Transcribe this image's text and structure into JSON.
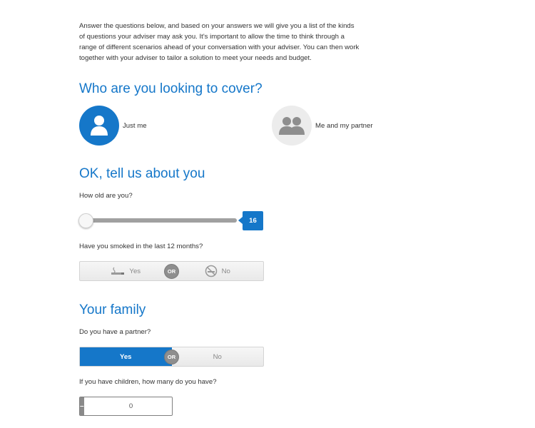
{
  "intro": "Answer the questions below, and based on your answers we will give you a list of the kinds of questions your adviser may ask you. It's important to allow the time to think through a range of different scenarios ahead of your conversation with your adviser. You can then work together with your adviser to tailor a solution to meet your needs and budget.",
  "cover": {
    "heading": "Who are you looking to cover?",
    "options": [
      {
        "label": "Just me",
        "icon": "person-icon",
        "selected": true
      },
      {
        "label": "Me and my partner",
        "icon": "couple-icon",
        "selected": false
      }
    ]
  },
  "about": {
    "heading": "OK, tell us about you",
    "age_question": "How old are you?",
    "age_value": "16",
    "smoke_question": "Have you smoked in the last 12 months?",
    "smoke_yes": "Yes",
    "smoke_or": "OR",
    "smoke_no": "No",
    "smoke_selected": null
  },
  "family": {
    "heading": "Your family",
    "partner_question": "Do you have a partner?",
    "partner_yes": "Yes",
    "partner_or": "OR",
    "partner_no": "No",
    "partner_selected": "Yes",
    "children_question": "If you have children, how many do you have?",
    "children_value": "0",
    "minus": "–",
    "plus": "+"
  },
  "colors": {
    "accent": "#1577c9",
    "inactive": "#8e8e8e"
  }
}
